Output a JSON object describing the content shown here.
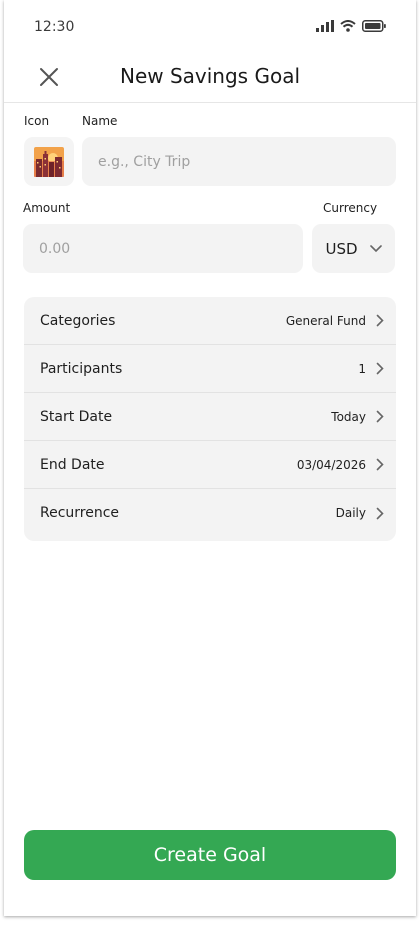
{
  "status_bar": {
    "time": "12:30",
    "icons": [
      "signal-icon",
      "wifi-icon",
      "battery-icon"
    ]
  },
  "header": {
    "title": "New Savings Goal",
    "close_icon": "close-icon"
  },
  "form": {
    "icon_label": "Icon",
    "icon_name": "city-sunset-icon",
    "name_label": "Name",
    "name_placeholder": "e.g., City Trip",
    "name_value": "",
    "amount_label": "Amount",
    "amount_placeholder": "0.00",
    "amount_value": "",
    "currency_label": "Currency",
    "currency_value": "USD"
  },
  "settings": {
    "rows": [
      {
        "label": "Categories",
        "value": "General Fund"
      },
      {
        "label": "Participants",
        "value": "1"
      },
      {
        "label": "Start Date",
        "value": "Today"
      },
      {
        "label": "End Date",
        "value": "03/04/2026"
      },
      {
        "label": "Recurrence",
        "value": "Daily"
      }
    ]
  },
  "actions": {
    "create_label": "Create Goal"
  },
  "colors": {
    "accent": "#34a853",
    "field_bg": "#f3f3f3",
    "divider": "#e2e2e2"
  }
}
